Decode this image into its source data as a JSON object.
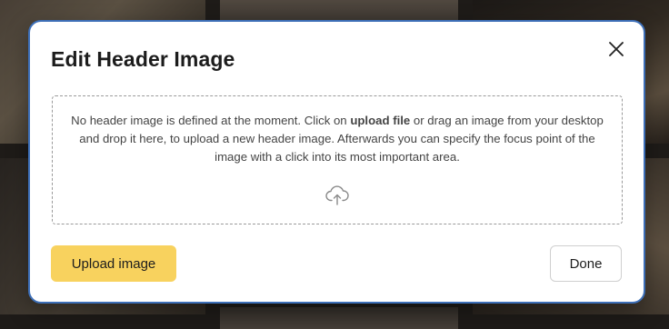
{
  "modal": {
    "title": "Edit Header Image",
    "close_icon": "close-icon",
    "dropzone": {
      "text_before": "No header image is defined at the moment. Click on ",
      "link_text": "upload file",
      "text_after": " or drag an image from your desktop and drop it here, to upload a new header image. Afterwards you can specify the focus point of the image with a click into its most important area.",
      "icon": "cloud-upload-icon"
    },
    "upload_button_label": "Upload image",
    "done_button_label": "Done"
  },
  "colors": {
    "accent_button": "#f8d25e",
    "modal_border": "#3d6fb8"
  }
}
